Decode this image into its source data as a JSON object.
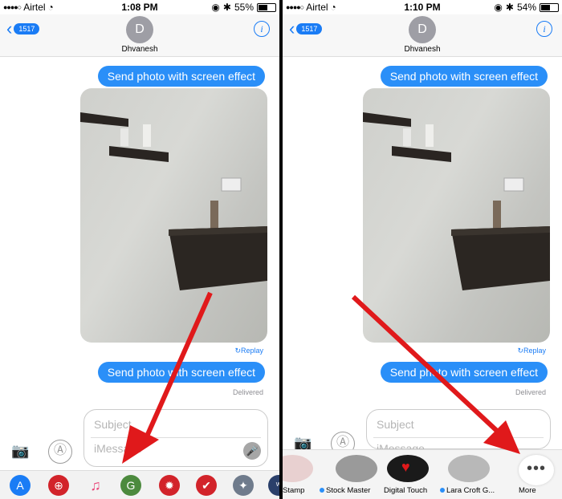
{
  "left": {
    "status": {
      "carrier": "Airtel",
      "time": "1:08 PM",
      "battery": "55%",
      "battery_level": 0.55
    },
    "nav": {
      "back_badge": "1517",
      "avatar_initial": "D",
      "contact_name": "Dhvanesh"
    },
    "messages": {
      "top_bubble": "Send photo with screen effect",
      "replay": "Replay",
      "bottom_bubble": "Send photo with screen effect",
      "status": "Delivered"
    },
    "input": {
      "subject_placeholder": "Subject",
      "message_placeholder": "iMessage"
    },
    "drawer_icons": [
      "app-store-icon",
      "browser-icon",
      "music-icon",
      "google-maps-icon",
      "settings-app-icon",
      "checkmark-app-icon",
      "sticker-app-icon",
      "the-web-app-icon"
    ]
  },
  "right": {
    "status": {
      "carrier": "Airtel",
      "time": "1:10 PM",
      "battery": "54%",
      "battery_level": 0.54
    },
    "nav": {
      "back_badge": "1517",
      "avatar_initial": "D",
      "contact_name": "Dhvanesh"
    },
    "messages": {
      "top_bubble": "Send photo with screen effect",
      "replay": "Replay",
      "bottom_bubble": "Send photo with screen effect",
      "status": "Delivered"
    },
    "input": {
      "subject_placeholder": "Subject",
      "message_placeholder": "iMessage"
    },
    "drawer_apps": [
      {
        "label": "Stamp",
        "dot": false
      },
      {
        "label": "Stock Master",
        "dot": true
      },
      {
        "label": "Digital Touch",
        "dot": false
      },
      {
        "label": "Lara Croft G...",
        "dot": true
      },
      {
        "label": "More",
        "dot": false
      }
    ]
  },
  "colors": {
    "bubble": "#2a8ff8",
    "link": "#1a7cf5",
    "arrow": "#e0191b"
  }
}
